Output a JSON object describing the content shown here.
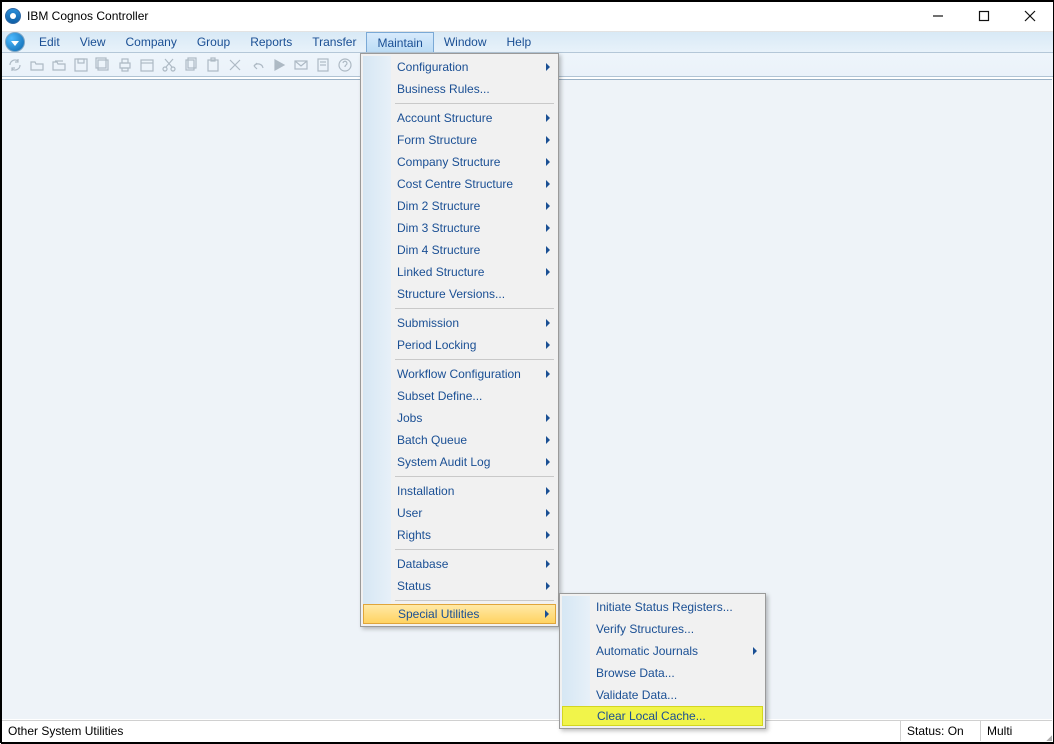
{
  "window": {
    "title": "IBM Cognos Controller"
  },
  "menubar": {
    "items": [
      "Edit",
      "View",
      "Company",
      "Group",
      "Reports",
      "Transfer",
      "Maintain",
      "Window",
      "Help"
    ],
    "open_index": 6
  },
  "toolbar": {
    "icons": [
      "refresh-icon",
      "open-icon",
      "open2-icon",
      "save-icon",
      "saveall-icon",
      "print-icon",
      "calendar-icon",
      "cut-icon",
      "copy-icon",
      "paste-icon",
      "delete-icon",
      "undo-icon",
      "run-icon",
      "mail-icon",
      "note-icon",
      "help-icon"
    ]
  },
  "maintain_menu": {
    "groups": [
      [
        {
          "label": "Configuration",
          "sub": true
        },
        {
          "label": "Business Rules..."
        }
      ],
      [
        {
          "label": "Account Structure",
          "sub": true
        },
        {
          "label": "Form Structure",
          "sub": true
        },
        {
          "label": "Company Structure",
          "sub": true
        },
        {
          "label": "Cost Centre Structure",
          "sub": true
        },
        {
          "label": "Dim 2 Structure",
          "sub": true
        },
        {
          "label": "Dim 3 Structure",
          "sub": true
        },
        {
          "label": "Dim 4 Structure",
          "sub": true
        },
        {
          "label": "Linked Structure",
          "sub": true
        },
        {
          "label": "Structure Versions..."
        }
      ],
      [
        {
          "label": "Submission",
          "sub": true
        },
        {
          "label": "Period Locking",
          "sub": true
        }
      ],
      [
        {
          "label": "Workflow Configuration",
          "sub": true
        },
        {
          "label": "Subset Define..."
        },
        {
          "label": "Jobs",
          "sub": true
        },
        {
          "label": "Batch Queue",
          "sub": true
        },
        {
          "label": "System Audit Log",
          "sub": true
        }
      ],
      [
        {
          "label": "Installation",
          "sub": true
        },
        {
          "label": "User",
          "sub": true
        },
        {
          "label": "Rights",
          "sub": true
        }
      ],
      [
        {
          "label": "Database",
          "sub": true
        },
        {
          "label": "Status",
          "sub": true
        }
      ],
      [
        {
          "label": "Special Utilities",
          "sub": true,
          "hover": true
        }
      ]
    ]
  },
  "special_utilities_submenu": {
    "groups": [
      [
        {
          "label": "Initiate Status Registers..."
        },
        {
          "label": "Verify Structures..."
        },
        {
          "label": "Automatic Journals",
          "sub": true
        },
        {
          "label": "Browse Data..."
        },
        {
          "label": "Validate Data..."
        },
        {
          "label": "Clear Local Cache...",
          "highlight": true
        }
      ]
    ]
  },
  "statusbar": {
    "left": "Other System Utilities",
    "status_label": "Status: On",
    "mode_label": "Multi"
  }
}
